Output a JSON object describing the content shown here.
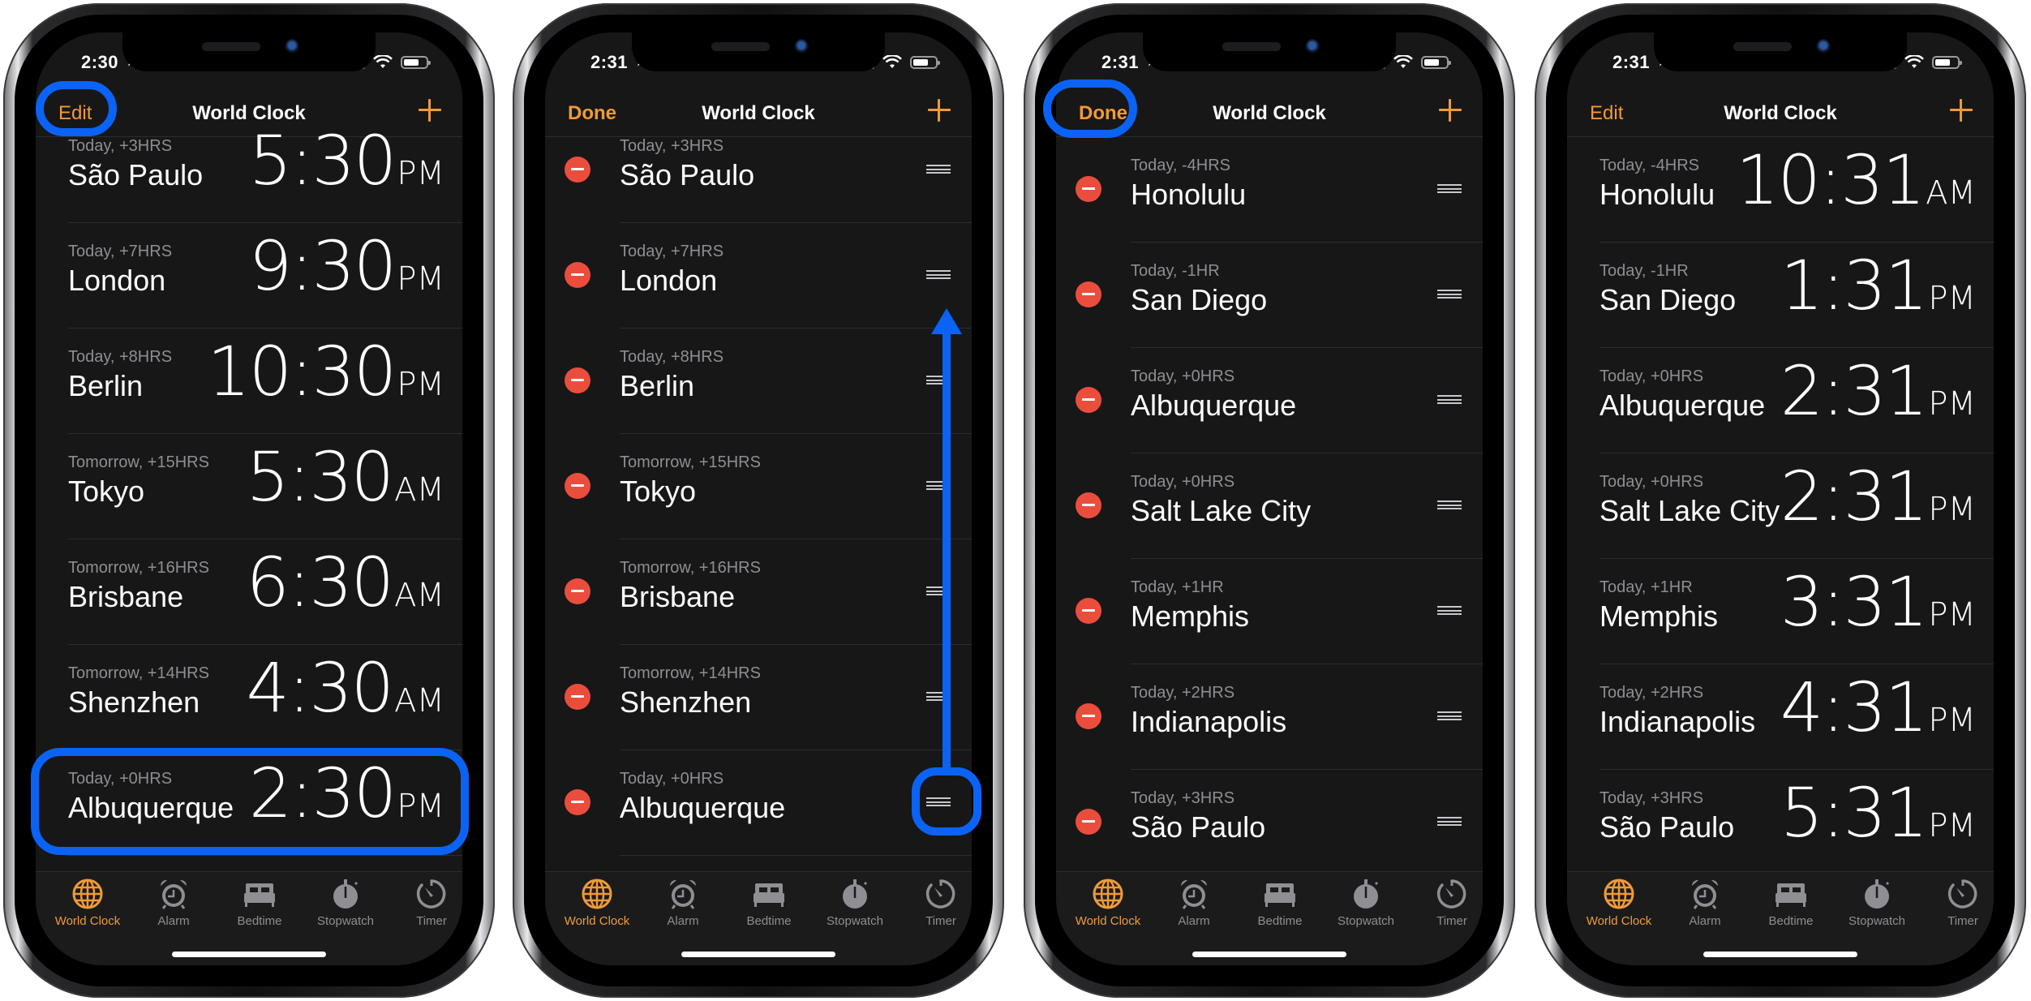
{
  "colors": {
    "accent": "#f09a37",
    "delete": "#eb4d3d",
    "annotation": "#0a63f5",
    "background": "#171717",
    "secondary_text": "#8e8e93"
  },
  "tabs": [
    {
      "label": "World Clock",
      "icon": "globe-icon",
      "active": true
    },
    {
      "label": "Alarm",
      "icon": "alarm-clock-icon",
      "active": false
    },
    {
      "label": "Bedtime",
      "icon": "bed-icon",
      "active": false
    },
    {
      "label": "Stopwatch",
      "icon": "stopwatch-icon",
      "active": false
    },
    {
      "label": "Timer",
      "icon": "timer-icon",
      "active": false
    }
  ],
  "phones": [
    {
      "status_time": "2:30",
      "nav": {
        "left_label": "Edit",
        "title": "World Clock",
        "add_label": "+"
      },
      "mode": "view",
      "annotations": [
        "edit-button-highlight",
        "albuquerque-row-highlight"
      ],
      "cities": [
        {
          "offset": "Today, +3HRS",
          "city": "São Paulo",
          "time": "5:30",
          "ampm": "PM"
        },
        {
          "offset": "Today, +7HRS",
          "city": "London",
          "time": "9:30",
          "ampm": "PM"
        },
        {
          "offset": "Today, +8HRS",
          "city": "Berlin",
          "time": "10:30",
          "ampm": "PM"
        },
        {
          "offset": "Tomorrow, +15HRS",
          "city": "Tokyo",
          "time": "5:30",
          "ampm": "AM"
        },
        {
          "offset": "Tomorrow, +16HRS",
          "city": "Brisbane",
          "time": "6:30",
          "ampm": "AM"
        },
        {
          "offset": "Tomorrow, +14HRS",
          "city": "Shenzhen",
          "time": "4:30",
          "ampm": "AM"
        },
        {
          "offset": "Today, +0HRS",
          "city": "Albuquerque",
          "time": "2:30",
          "ampm": "PM"
        }
      ]
    },
    {
      "status_time": "2:31",
      "nav": {
        "left_label": "Done",
        "title": "World Clock",
        "add_label": "+"
      },
      "mode": "edit",
      "annotations": [
        "drag-handle-highlight",
        "drag-up-arrow"
      ],
      "cities": [
        {
          "offset": "Today, +3HRS",
          "city": "São Paulo"
        },
        {
          "offset": "Today, +7HRS",
          "city": "London"
        },
        {
          "offset": "Today, +8HRS",
          "city": "Berlin"
        },
        {
          "offset": "Tomorrow, +15HRS",
          "city": "Tokyo"
        },
        {
          "offset": "Tomorrow, +16HRS",
          "city": "Brisbane"
        },
        {
          "offset": "Tomorrow, +14HRS",
          "city": "Shenzhen"
        },
        {
          "offset": "Today, +0HRS",
          "city": "Albuquerque"
        }
      ]
    },
    {
      "status_time": "2:31",
      "nav": {
        "left_label": "Done",
        "title": "World Clock",
        "add_label": "+"
      },
      "mode": "edit",
      "annotations": [
        "done-button-highlight"
      ],
      "cities": [
        {
          "offset": "Today, -4HRS",
          "city": "Honolulu"
        },
        {
          "offset": "Today, -1HR",
          "city": "San Diego"
        },
        {
          "offset": "Today, +0HRS",
          "city": "Albuquerque"
        },
        {
          "offset": "Today, +0HRS",
          "city": "Salt Lake City"
        },
        {
          "offset": "Today, +1HR",
          "city": "Memphis"
        },
        {
          "offset": "Today, +2HRS",
          "city": "Indianapolis"
        },
        {
          "offset": "Today, +3HRS",
          "city": "São Paulo"
        }
      ]
    },
    {
      "status_time": "2:31",
      "nav": {
        "left_label": "Edit",
        "title": "World Clock",
        "add_label": "+"
      },
      "mode": "view",
      "annotations": [],
      "cities": [
        {
          "offset": "Today, -4HRS",
          "city": "Honolulu",
          "time": "10:31",
          "ampm": "AM"
        },
        {
          "offset": "Today, -1HR",
          "city": "San Diego",
          "time": "1:31",
          "ampm": "PM"
        },
        {
          "offset": "Today, +0HRS",
          "city": "Albuquerque",
          "time": "2:31",
          "ampm": "PM"
        },
        {
          "offset": "Today, +0HRS",
          "city": "Salt Lake City",
          "time": "2:31",
          "ampm": "PM"
        },
        {
          "offset": "Today, +1HR",
          "city": "Memphis",
          "time": "3:31",
          "ampm": "PM"
        },
        {
          "offset": "Today, +2HRS",
          "city": "Indianapolis",
          "time": "4:31",
          "ampm": "PM"
        },
        {
          "offset": "Today, +3HRS",
          "city": "São Paulo",
          "time": "5:31",
          "ampm": "PM"
        }
      ]
    }
  ]
}
